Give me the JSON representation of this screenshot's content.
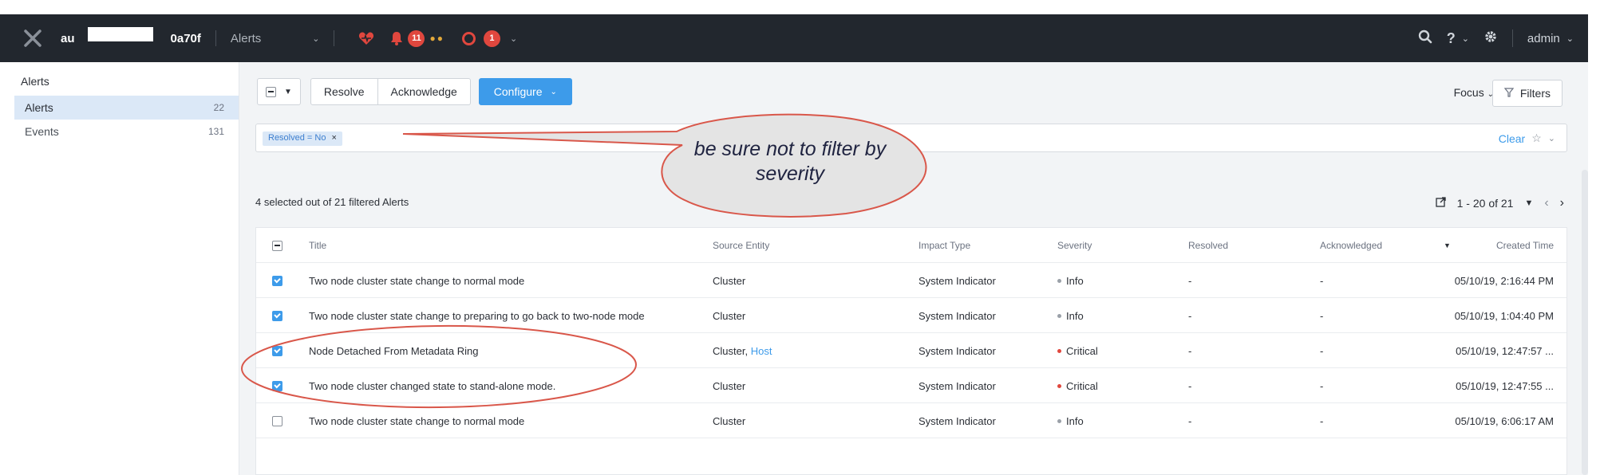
{
  "topbar": {
    "cluster_name_start": "au",
    "cluster_name_end": "0a70f",
    "section": "Alerts",
    "alert_count": "11",
    "critical_count": "1",
    "user": "admin"
  },
  "sidebar": {
    "title": "Alerts",
    "items": [
      {
        "label": "Alerts",
        "count": "22"
      },
      {
        "label": "Events",
        "count": "131"
      }
    ]
  },
  "toolbar": {
    "resolve": "Resolve",
    "acknowledge": "Acknowledge",
    "configure": "Configure",
    "focus": "Focus",
    "filters": "Filters"
  },
  "filter": {
    "chip": "Resolved = No",
    "clear": "Clear"
  },
  "summary": {
    "selected": "4 selected out of 21 filtered Alerts",
    "range": "1 - 20 of 21"
  },
  "table": {
    "headers": {
      "title": "Title",
      "source": "Source Entity",
      "impact": "Impact Type",
      "severity": "Severity",
      "resolved": "Resolved",
      "acknowledged": "Acknowledged",
      "created": "Created Time"
    },
    "rows": [
      {
        "title": "Two node cluster state change to normal mode",
        "source": "Cluster",
        "source_link": "",
        "impact": "System Indicator",
        "severity": "Info",
        "resolved": "-",
        "acknowledged": "-",
        "created": "05/10/19, 2:16:44 PM"
      },
      {
        "title": "Two node cluster state change to preparing to go back to two-node mode",
        "source": "Cluster",
        "source_link": "",
        "impact": "System Indicator",
        "severity": "Info",
        "resolved": "-",
        "acknowledged": "-",
        "created": "05/10/19, 1:04:40 PM"
      },
      {
        "title": "Node Detached From Metadata Ring",
        "source": "Cluster,",
        "source_link": "Host",
        "impact": "System Indicator",
        "severity": "Critical",
        "resolved": "-",
        "acknowledged": "-",
        "created": "05/10/19, 12:47:57 ..."
      },
      {
        "title": "Two node cluster changed state to stand-alone mode.",
        "source": "Cluster",
        "source_link": "",
        "impact": "System Indicator",
        "severity": "Critical",
        "resolved": "-",
        "acknowledged": "-",
        "created": "05/10/19, 12:47:55 ..."
      },
      {
        "title": "Two node cluster state change to normal mode",
        "source": "Cluster",
        "source_link": "",
        "impact": "System Indicator",
        "severity": "Info",
        "resolved": "-",
        "acknowledged": "-",
        "created": "05/10/19, 6:06:17 AM"
      }
    ]
  },
  "annotation": {
    "line1": "be sure not to filter by",
    "line2": "severity"
  },
  "colors": {
    "info": "#9aa0a8",
    "critical": "#e0473e",
    "primary": "#3d9bea",
    "annotation": "#d9574a"
  }
}
